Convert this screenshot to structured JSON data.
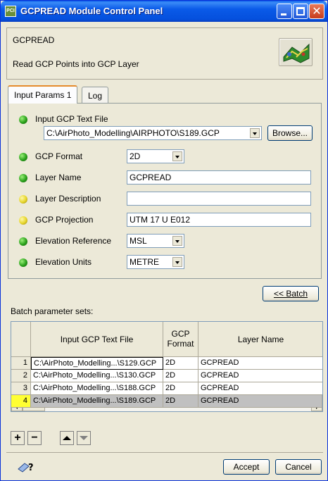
{
  "window": {
    "title": "GCPREAD Module Control Panel"
  },
  "header": {
    "module_name": "GCPREAD",
    "description": "Read GCP Points into GCP Layer"
  },
  "tabs": [
    {
      "label": "Input Params 1",
      "active": true
    },
    {
      "label": "Log",
      "active": false
    }
  ],
  "fields": {
    "gcp_file": {
      "label": "Input GCP Text File",
      "value": "C:\\AirPhoto_Modelling\\AIRPHOTO\\S189.GCP",
      "status": "green"
    },
    "browse_label": "Browse...",
    "gcp_format": {
      "label": "GCP Format",
      "value": "2D",
      "status": "green"
    },
    "layer_name": {
      "label": "Layer Name",
      "value": "GCPREAD",
      "status": "green"
    },
    "layer_description": {
      "label": "Layer Description",
      "value": "",
      "status": "yellow"
    },
    "gcp_projection": {
      "label": "GCP Projection",
      "value": "UTM 17 U E012",
      "status": "yellow"
    },
    "elevation_reference": {
      "label": "Elevation Reference",
      "value": "MSL",
      "status": "green"
    },
    "elevation_units": {
      "label": "Elevation Units",
      "value": "METRE",
      "status": "green"
    }
  },
  "batch": {
    "toggle_label": "<< Batch",
    "section_label": "Batch parameter sets:",
    "columns": [
      "Input GCP Text File",
      "GCP Format",
      "Layer Name"
    ],
    "rows": [
      {
        "num": "1",
        "file": "C:\\AirPhoto_Modelling...\\S129.GCP",
        "format": "2D",
        "layer": "GCPREAD"
      },
      {
        "num": "2",
        "file": "C:\\AirPhoto_Modelling...\\S130.GCP",
        "format": "2D",
        "layer": "GCPREAD"
      },
      {
        "num": "3",
        "file": "C:\\AirPhoto_Modelling...\\S188.GCP",
        "format": "2D",
        "layer": "GCPREAD"
      },
      {
        "num": "4",
        "file": "C:\\AirPhoto_Modelling...\\S189.GCP",
        "format": "2D",
        "layer": "GCPREAD"
      }
    ],
    "selected_row": "4"
  },
  "row_controls": {
    "add": "+",
    "remove": "−"
  },
  "footer": {
    "accept_label": "Accept",
    "cancel_label": "Cancel"
  },
  "colors": {
    "status_green": "#2aa11b",
    "status_yellow": "#e6d52a",
    "selected_row_marker": "#ffff33",
    "titlebar": "#0a5ae8"
  }
}
